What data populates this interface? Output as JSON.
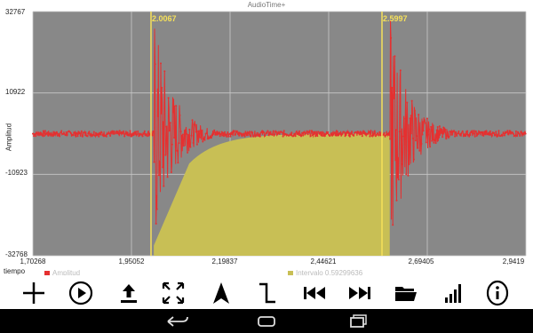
{
  "app": {
    "title": "AudioTime+"
  },
  "plot": {
    "background": "#888888",
    "wave_color": "#e53030",
    "fill_color": "#c8bf55",
    "marker_color": "#f5e05a",
    "y_tick_labels": [
      "32767",
      "10922",
      "-10923",
      "-32768"
    ],
    "x_tick_labels": [
      "1,70268",
      "1,95052",
      "2,19837",
      "2,44621",
      "2,69405",
      "2,9419"
    ],
    "y_axis_label": "Amplitud",
    "x_axis_label": "tiempo",
    "marker_left": "2.0067",
    "marker_right": "2.5997",
    "legend_amplitud": "Amplitud",
    "legend_intervalo": "Intervalo 0.59299636"
  },
  "chart_data": {
    "type": "line",
    "title": "AudioTime+",
    "xlabel": "tiempo",
    "ylabel": "Amplitud",
    "xlim": [
      1.70268,
      2.9419
    ],
    "ylim": [
      -32768,
      32767
    ],
    "series": [
      {
        "name": "Amplitud",
        "description": "audio waveform with two bursts"
      },
      {
        "name": "Intervalo 0.59299636",
        "start": 2.0067,
        "end": 2.5997
      }
    ]
  },
  "toolbar": {
    "items": [
      "plus-icon",
      "play-icon",
      "upload-icon",
      "fullscreen-icon",
      "cursor-arrow-icon",
      "step-icon",
      "rewind-icon",
      "fast-forward-icon",
      "folder-icon",
      "signal-bars-icon",
      "info-icon"
    ]
  },
  "navbar": {
    "items": [
      "back-icon",
      "home-icon",
      "recents-icon"
    ]
  }
}
